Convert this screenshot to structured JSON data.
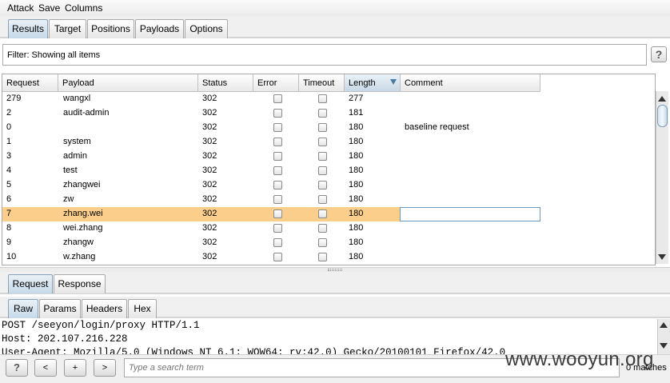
{
  "menu": {
    "items": [
      "Attack",
      "Save",
      "Columns"
    ]
  },
  "top_tabs": [
    "Results",
    "Target",
    "Positions",
    "Payloads",
    "Options"
  ],
  "filter": {
    "text": "Filter:  Showing all items",
    "help": "?"
  },
  "table": {
    "columns": [
      "Request",
      "Payload",
      "Status",
      "Error",
      "Timeout",
      "Length",
      "Comment"
    ],
    "sorted_column": "Length",
    "rows": [
      {
        "request": "279",
        "payload": "wangxl",
        "status": "302",
        "length": "277",
        "comment": ""
      },
      {
        "request": "2",
        "payload": "audit-admin",
        "status": "302",
        "length": "181",
        "comment": ""
      },
      {
        "request": "0",
        "payload": "",
        "status": "302",
        "length": "180",
        "comment": "baseline request"
      },
      {
        "request": "1",
        "payload": "system",
        "status": "302",
        "length": "180",
        "comment": ""
      },
      {
        "request": "3",
        "payload": "admin",
        "status": "302",
        "length": "180",
        "comment": ""
      },
      {
        "request": "4",
        "payload": "test",
        "status": "302",
        "length": "180",
        "comment": ""
      },
      {
        "request": "5",
        "payload": "zhangwei",
        "status": "302",
        "length": "180",
        "comment": ""
      },
      {
        "request": "6",
        "payload": "zw",
        "status": "302",
        "length": "180",
        "comment": ""
      },
      {
        "request": "7",
        "payload": "zhang.wei",
        "status": "302",
        "length": "180",
        "comment": "",
        "selected": true
      },
      {
        "request": "8",
        "payload": "wei.zhang",
        "status": "302",
        "length": "180",
        "comment": ""
      },
      {
        "request": "9",
        "payload": "zhangw",
        "status": "302",
        "length": "180",
        "comment": ""
      },
      {
        "request": "10",
        "payload": "w.zhang",
        "status": "302",
        "length": "180",
        "comment": ""
      }
    ]
  },
  "detail_tabs": [
    "Request",
    "Response"
  ],
  "view_tabs": [
    "Raw",
    "Params",
    "Headers",
    "Hex"
  ],
  "raw_lines": [
    "POST /seeyon/login/proxy HTTP/1.1",
    "Host: 202.107.216.228",
    "User-Agent: Mozilla/5.0 (Windows NT 6.1; WOW64; rv:42.0) Gecko/20100101 Firefox/42.0"
  ],
  "bottom_bar": {
    "help": "?",
    "prev": "<",
    "add": "+",
    "next": ">",
    "search_placeholder": "Type a search term",
    "matches": "0 matches"
  },
  "watermark": "www.wooyun.org",
  "colors": {
    "selected_row": "#fcce8c",
    "active_tab": "#c6d9e8"
  }
}
